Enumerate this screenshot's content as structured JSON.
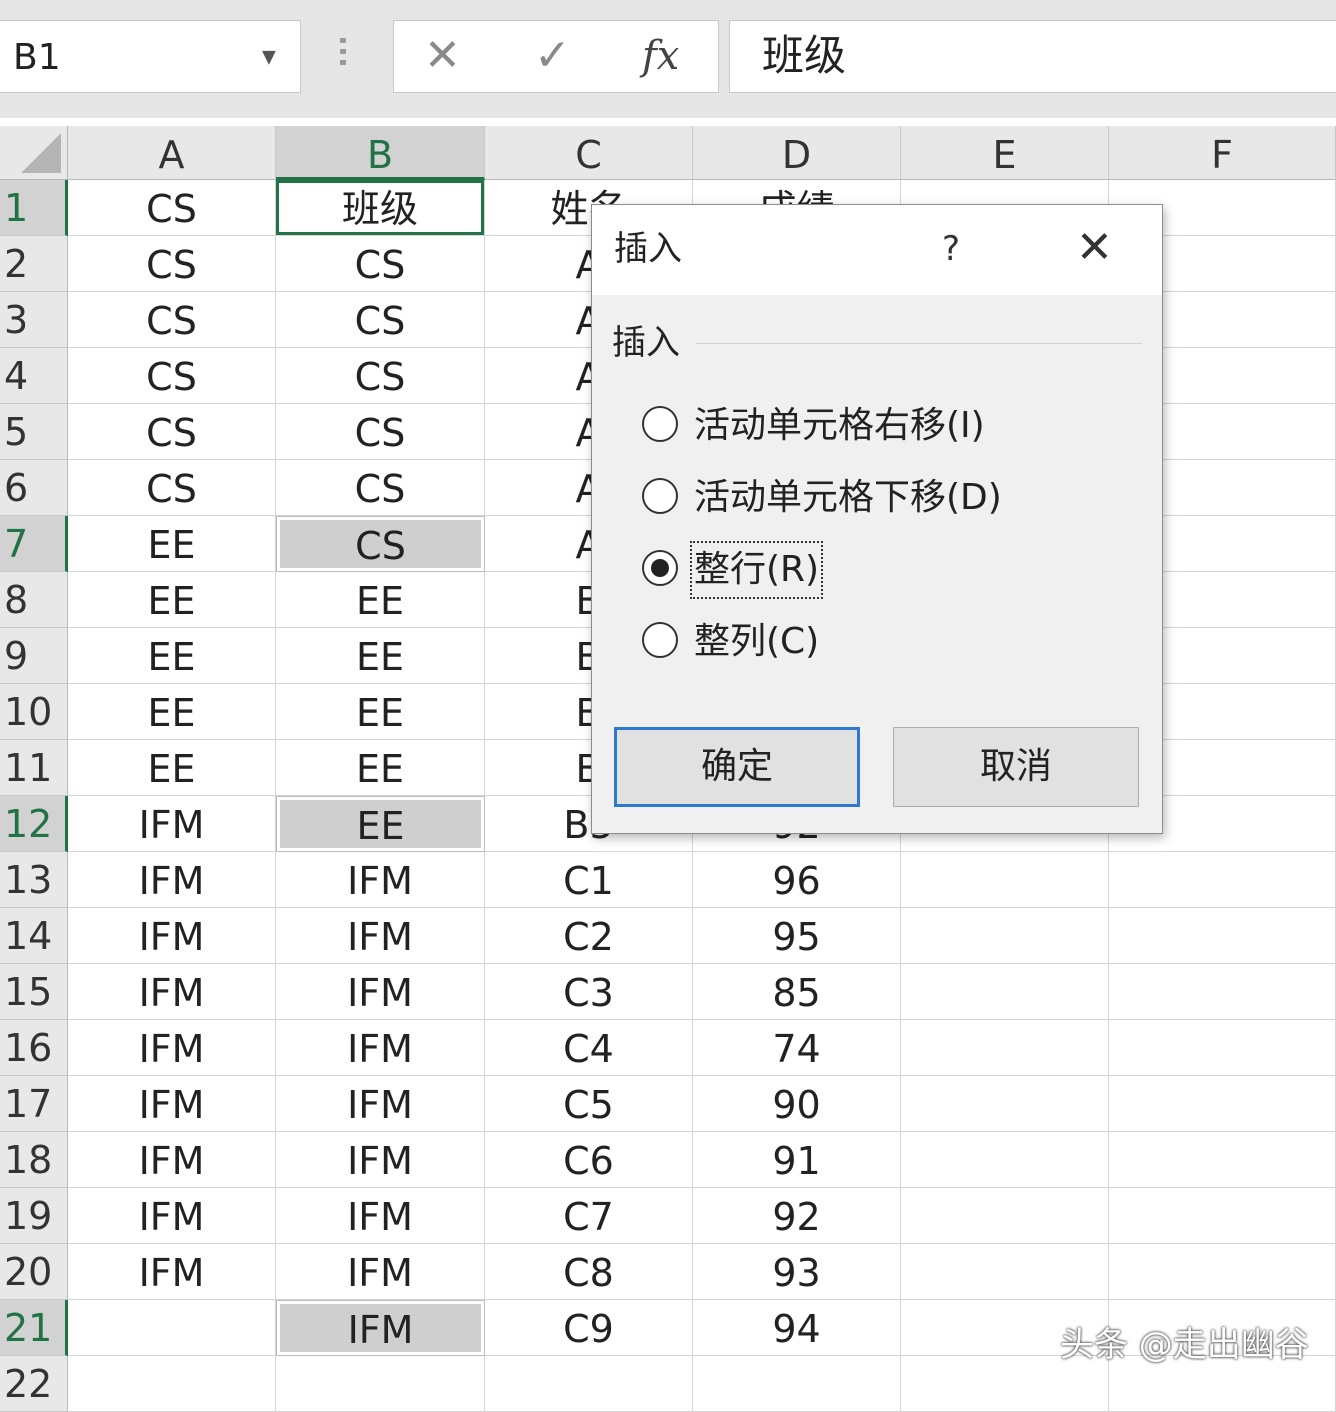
{
  "formula_bar": {
    "name_box": "B1",
    "cancel_glyph": "✕",
    "enter_glyph": "✓",
    "fx_glyph": "fx",
    "formula": "班级"
  },
  "columns": [
    "A",
    "B",
    "C",
    "D",
    "E",
    "F"
  ],
  "rows": [
    {
      "n": "1",
      "A": "CS",
      "B": "班级",
      "C": "姓名",
      "D": "成绩"
    },
    {
      "n": "2",
      "A": "CS",
      "B": "CS",
      "C": "A",
      "D": ""
    },
    {
      "n": "3",
      "A": "CS",
      "B": "CS",
      "C": "A",
      "D": ""
    },
    {
      "n": "4",
      "A": "CS",
      "B": "CS",
      "C": "A",
      "D": ""
    },
    {
      "n": "5",
      "A": "CS",
      "B": "CS",
      "C": "A",
      "D": ""
    },
    {
      "n": "6",
      "A": "CS",
      "B": "CS",
      "C": "A",
      "D": ""
    },
    {
      "n": "7",
      "A": "EE",
      "B": "CS",
      "C": "A",
      "D": ""
    },
    {
      "n": "8",
      "A": "EE",
      "B": "EE",
      "C": "B",
      "D": ""
    },
    {
      "n": "9",
      "A": "EE",
      "B": "EE",
      "C": "B",
      "D": ""
    },
    {
      "n": "10",
      "A": "EE",
      "B": "EE",
      "C": "B",
      "D": ""
    },
    {
      "n": "11",
      "A": "EE",
      "B": "EE",
      "C": "B",
      "D": ""
    },
    {
      "n": "12",
      "A": "IFM",
      "B": "EE",
      "C": "B5",
      "D": "92"
    },
    {
      "n": "13",
      "A": "IFM",
      "B": "IFM",
      "C": "C1",
      "D": "96"
    },
    {
      "n": "14",
      "A": "IFM",
      "B": "IFM",
      "C": "C2",
      "D": "95"
    },
    {
      "n": "15",
      "A": "IFM",
      "B": "IFM",
      "C": "C3",
      "D": "85"
    },
    {
      "n": "16",
      "A": "IFM",
      "B": "IFM",
      "C": "C4",
      "D": "74"
    },
    {
      "n": "17",
      "A": "IFM",
      "B": "IFM",
      "C": "C5",
      "D": "90"
    },
    {
      "n": "18",
      "A": "IFM",
      "B": "IFM",
      "C": "C6",
      "D": "91"
    },
    {
      "n": "19",
      "A": "IFM",
      "B": "IFM",
      "C": "C7",
      "D": "92"
    },
    {
      "n": "20",
      "A": "IFM",
      "B": "IFM",
      "C": "C8",
      "D": "93"
    },
    {
      "n": "21",
      "A": "",
      "B": "IFM",
      "C": "C9",
      "D": "94"
    },
    {
      "n": "22",
      "A": "",
      "B": "",
      "C": "",
      "D": ""
    }
  ],
  "selected_rows": [
    "1",
    "7",
    "12",
    "21"
  ],
  "gray_cells_B": [
    "7",
    "12",
    "21"
  ],
  "dialog": {
    "title": "插入",
    "help": "?",
    "close": "✕",
    "group_label": "插入",
    "options": [
      {
        "label": "活动单元格右移(I)",
        "checked": false
      },
      {
        "label": "活动单元格下移(D)",
        "checked": false
      },
      {
        "label": "整行(R)",
        "checked": true
      },
      {
        "label": "整列(C)",
        "checked": false
      }
    ],
    "ok_label": "确定",
    "cancel_label": "取消"
  },
  "watermark": "头条 @走出幽谷",
  "colors": {
    "accent_green": "#217346",
    "ok_border": "#2c7bd1"
  }
}
